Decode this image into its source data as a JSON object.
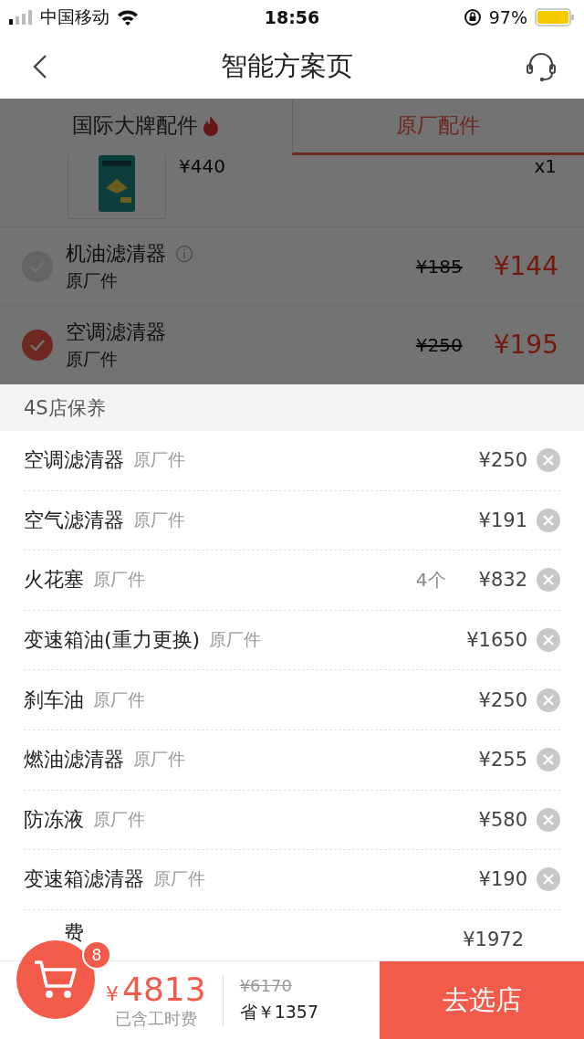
{
  "status_bar": {
    "carrier": "中国移动",
    "time": "18:56",
    "battery": "97%"
  },
  "nav": {
    "title": "智能方案页"
  },
  "tabs": [
    {
      "label": "国际大牌配件",
      "selected": false,
      "hot": true
    },
    {
      "label": "原厂配件",
      "selected": true,
      "hot": false
    }
  ],
  "product": {
    "kind": "picture",
    "price": "¥440",
    "quantity": "x1"
  },
  "parts": [
    {
      "name": "机油滤清器",
      "info": true,
      "brand": "原厂件",
      "original_price": "¥185",
      "price": "¥144",
      "checked": false
    },
    {
      "name": "空调滤清器",
      "info": false,
      "brand": "原厂件",
      "original_price": "¥250",
      "price": "¥195",
      "checked": true
    }
  ],
  "sheet": {
    "title": "4S店保养",
    "items": [
      {
        "name": "空调滤清器",
        "brand": "原厂件",
        "price": "¥250",
        "removable": true
      },
      {
        "name": "空气滤清器",
        "brand": "原厂件",
        "price": "¥191",
        "removable": true
      },
      {
        "name": "火花塞",
        "brand": "原厂件",
        "quantity": "4个",
        "price": "¥832",
        "removable": true
      },
      {
        "name": "变速箱油(重力更换)",
        "brand": "原厂件",
        "price": "¥1650",
        "removable": true
      },
      {
        "name": "刹车油",
        "brand": "原厂件",
        "price": "¥250",
        "removable": true
      },
      {
        "name": "燃油滤清器",
        "brand": "原厂件",
        "price": "¥255",
        "removable": true
      },
      {
        "name": "防冻液",
        "brand": "原厂件",
        "price": "¥580",
        "removable": true
      },
      {
        "name": "变速箱滤清器",
        "brand": "原厂件",
        "price": "¥190",
        "removable": true
      },
      {
        "name": "费",
        "price": "¥1972",
        "removable": false
      }
    ]
  },
  "footer": {
    "cart_count": "8",
    "currency": "¥",
    "total": "4813",
    "note": "已含工时费",
    "original_total": "¥6170",
    "saving": "省￥1357",
    "button": "去选店"
  }
}
